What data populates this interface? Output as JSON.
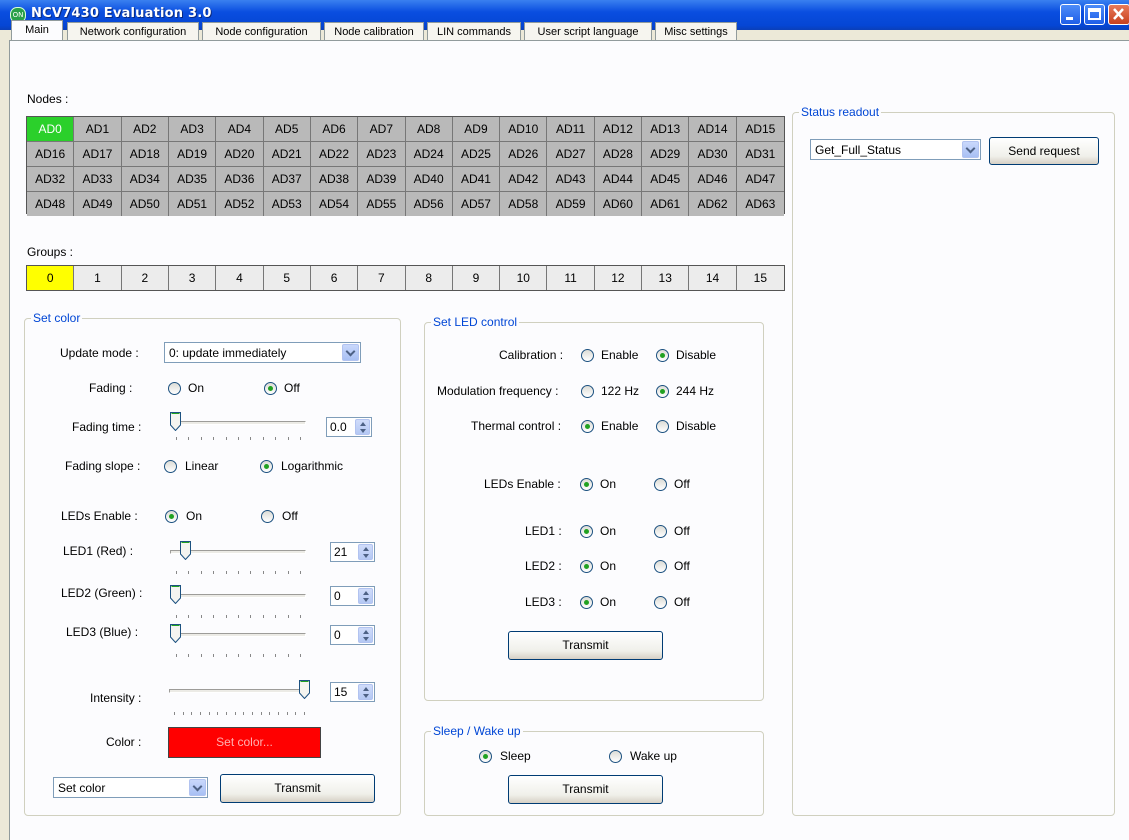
{
  "window": {
    "title": "NCV7430 Evaluation 3.0"
  },
  "tabs": [
    "Main",
    "Network configuration",
    "Node configuration",
    "Node calibration",
    "LIN commands",
    "User script language",
    "Misc settings"
  ],
  "nodes": {
    "label": "Nodes :",
    "selected": "AD0",
    "rows": [
      [
        "AD0",
        "AD1",
        "AD2",
        "AD3",
        "AD4",
        "AD5",
        "AD6",
        "AD7",
        "AD8",
        "AD9",
        "AD10",
        "AD11",
        "AD12",
        "AD13",
        "AD14",
        "AD15"
      ],
      [
        "AD16",
        "AD17",
        "AD18",
        "AD19",
        "AD20",
        "AD21",
        "AD22",
        "AD23",
        "AD24",
        "AD25",
        "AD26",
        "AD27",
        "AD28",
        "AD29",
        "AD30",
        "AD31"
      ],
      [
        "AD32",
        "AD33",
        "AD34",
        "AD35",
        "AD36",
        "AD37",
        "AD38",
        "AD39",
        "AD40",
        "AD41",
        "AD42",
        "AD43",
        "AD44",
        "AD45",
        "AD46",
        "AD47"
      ],
      [
        "AD48",
        "AD49",
        "AD50",
        "AD51",
        "AD52",
        "AD53",
        "AD54",
        "AD55",
        "AD56",
        "AD57",
        "AD58",
        "AD59",
        "AD60",
        "AD61",
        "AD62",
        "AD63"
      ]
    ]
  },
  "groups": {
    "label": "Groups :",
    "selected": "0",
    "items": [
      "0",
      "1",
      "2",
      "3",
      "4",
      "5",
      "6",
      "7",
      "8",
      "9",
      "10",
      "11",
      "12",
      "13",
      "14",
      "15"
    ]
  },
  "set_color": {
    "title": "Set color",
    "update_mode_label": "Update mode :",
    "update_mode_value": "0: update immediately",
    "fading_label": "Fading :",
    "fading_on": "On",
    "fading_off": "Off",
    "fading_selected": "Off",
    "fading_time_label": "Fading time :",
    "fading_time_value": "0.0",
    "fading_time_fraction": 0.0,
    "fading_slope_label": "Fading slope :",
    "fading_slope_linear": "Linear",
    "fading_slope_log": "Logarithmic",
    "fading_slope_selected": "Logarithmic",
    "leds_enable_label": "LEDs Enable :",
    "leds_enable_on": "On",
    "leds_enable_off": "Off",
    "leds_enable_selected": "On",
    "led1_label": "LED1 (Red) :",
    "led1_value": "21",
    "led1_fraction": 0.08,
    "led2_label": "LED2 (Green) :",
    "led2_value": "0",
    "led2_fraction": 0.0,
    "led3_label": "LED3 (Blue) :",
    "led3_value": "0",
    "led3_fraction": 0.0,
    "intensity_label": "Intensity :",
    "intensity_value": "15",
    "intensity_fraction": 1.0,
    "color_label": "Color :",
    "color_button": "Set color...",
    "color_hex": "#ff0000",
    "command_value": "Set color",
    "transmit": "Transmit"
  },
  "led_control": {
    "title": "Set LED control",
    "calibration_label": "Calibration :",
    "calibration_enable": "Enable",
    "calibration_disable": "Disable",
    "calibration_selected": "Disable",
    "modulation_label": "Modulation frequency :",
    "modulation_122": "122 Hz",
    "modulation_244": "244 Hz",
    "modulation_selected": "244 Hz",
    "thermal_label": "Thermal control :",
    "thermal_enable": "Enable",
    "thermal_disable": "Disable",
    "thermal_selected": "Enable",
    "leds_enable_label": "LEDs Enable :",
    "leds_enable_on": "On",
    "leds_enable_off": "Off",
    "led1_label": "LED1 :",
    "led2_label": "LED2 :",
    "led3_label": "LED3 :",
    "on": "On",
    "off": "Off",
    "transmit": "Transmit"
  },
  "sleep": {
    "title": "Sleep / Wake up",
    "sleep": "Sleep",
    "wake": "Wake up",
    "selected": "Sleep",
    "transmit": "Transmit"
  },
  "status": {
    "title": "Status readout",
    "request_value": "Get_Full_Status",
    "send_button": "Send request"
  }
}
